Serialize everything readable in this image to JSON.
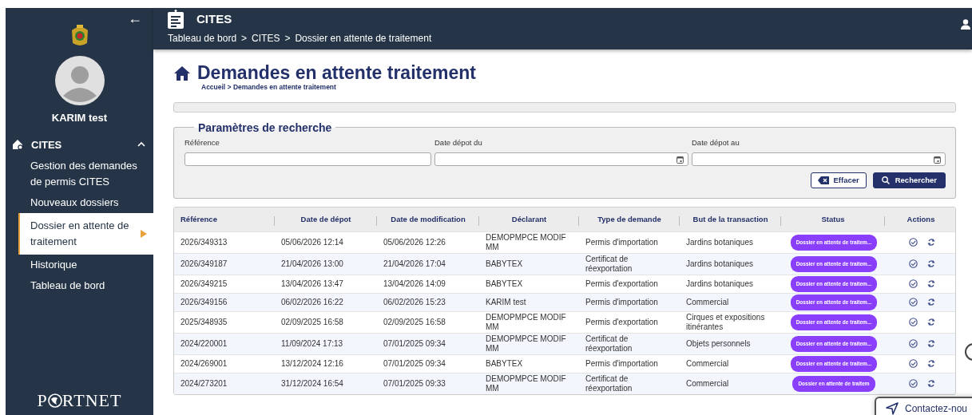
{
  "sidebar": {
    "back": "←",
    "user_name": "KARIM test",
    "group": {
      "label": "CITES",
      "expanded": true,
      "items": [
        {
          "label": "Gestion des demandes de permis CITES",
          "selected": false
        },
        {
          "label": "Nouveaux dossiers",
          "selected": false
        },
        {
          "label": "Dossier en attente de traitement",
          "selected": true
        },
        {
          "label": "Historique",
          "selected": false
        },
        {
          "label": "Tableau de bord",
          "selected": false
        }
      ]
    },
    "logo": {
      "before": "P",
      "after": "RTNET"
    }
  },
  "header": {
    "title": "CITES",
    "breadcrumb": [
      "Tableau de bord",
      "CITES",
      "Dossier en attente de traitement"
    ],
    "separator": ">"
  },
  "page": {
    "title": "Demandes en attente traitement",
    "subtitle": "Accueil > Demandes en attente traitement"
  },
  "search": {
    "legend": "Paramètres de recherche",
    "fields": [
      {
        "label": "Référence",
        "kind": "text"
      },
      {
        "label": "Date dépot du",
        "kind": "date"
      },
      {
        "label": "Date dépot au",
        "kind": "date"
      }
    ],
    "buttons": [
      {
        "label": "Effacer",
        "kind": "clear"
      },
      {
        "label": "Rechercher",
        "kind": "search"
      }
    ]
  },
  "table": {
    "columns": [
      "Référence",
      "Date de dépot",
      "Date de modification",
      "Déclarant",
      "Type de demande",
      "But de la transaction",
      "Status",
      "Actions"
    ],
    "rows": [
      {
        "reference": "2026/349313",
        "date_depot": "05/06/2026 12:14",
        "date_modification": "05/06/2026 12:26",
        "declarant": "DEMOPMPCE MODIF MM",
        "type": "Permis d'importation",
        "but": "Jardins botaniques",
        "status": "Dossier en attente de traitem..."
      },
      {
        "reference": "2026/349187",
        "date_depot": "21/04/2026 13:00",
        "date_modification": "21/04/2026 17:04",
        "declarant": "BABYTEX",
        "type": "Certificat de réexportation",
        "but": "Jardins botaniques",
        "status": "Dossier en attente de traitem..."
      },
      {
        "reference": "2026/349215",
        "date_depot": "13/04/2026 13:47",
        "date_modification": "13/04/2026 14:09",
        "declarant": "BABYTEX",
        "type": "Permis d'exportation",
        "but": "Jardins botaniques",
        "status": "Dossier en attente de traitem..."
      },
      {
        "reference": "2026/349156",
        "date_depot": "06/02/2026 16:22",
        "date_modification": "06/02/2026 15:23",
        "declarant": "KARIM test",
        "type": "Permis d'importation",
        "but": "Commercial",
        "status": "Dossier en attente de traitem..."
      },
      {
        "reference": "2025/348935",
        "date_depot": "02/09/2025 16:58",
        "date_modification": "02/09/2025 16:58",
        "declarant": "DEMOPMPCE MODIF MM",
        "type": "Permis d'exportation",
        "but": "Cirques et expositions itinérantes",
        "status": "Dossier en attente de traitem..."
      },
      {
        "reference": "2024/220001",
        "date_depot": "11/09/2024 17:13",
        "date_modification": "07/01/2025 09:34",
        "declarant": "DEMOPMPCE MODIF MM",
        "type": "Certificat de réexportation",
        "but": "Objets personnels",
        "status": "Dossier en attente de traitem..."
      },
      {
        "reference": "2024/269001",
        "date_depot": "13/12/2024 12:16",
        "date_modification": "07/01/2025 09:34",
        "declarant": "BABYTEX",
        "type": "Permis d'importation",
        "but": "Commercial",
        "status": "Dossier en attente de traitem..."
      },
      {
        "reference": "2024/273201",
        "date_depot": "31/12/2024 16:54",
        "date_modification": "07/01/2025 09:33",
        "declarant": "DEMOPMPCE MODIF MM",
        "type": "Certificat de réexportation",
        "but": "Commercial",
        "status": "Dossier en attente de traitem"
      }
    ]
  },
  "contact": {
    "label": "Contactez-nou"
  }
}
